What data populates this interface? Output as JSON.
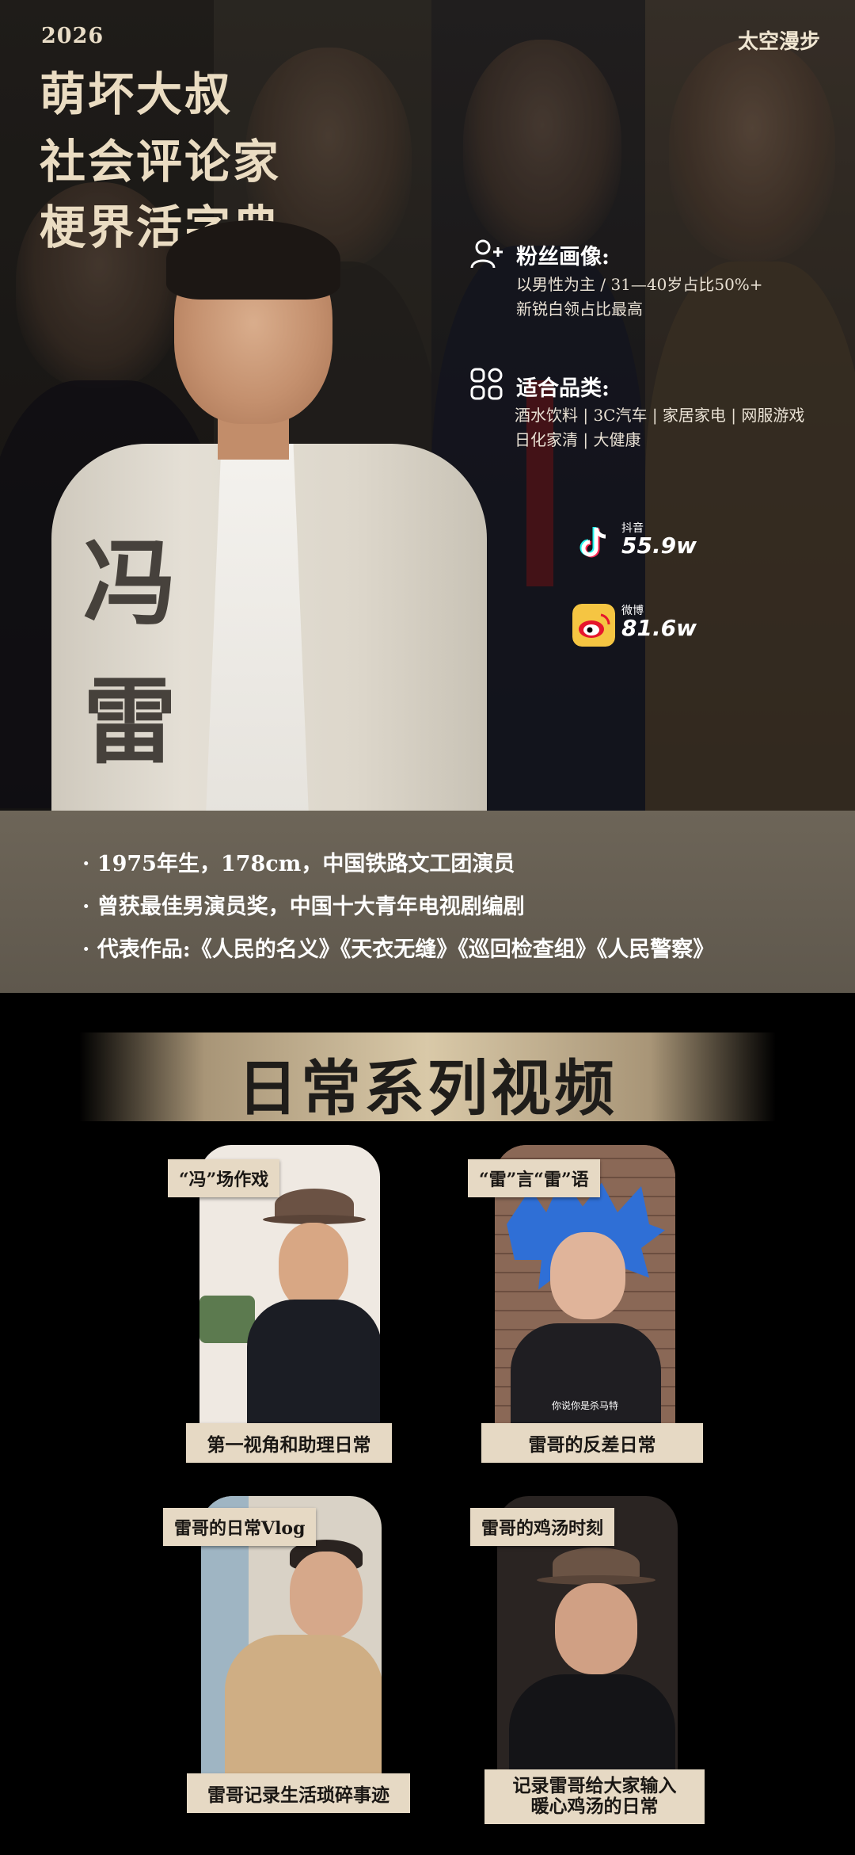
{
  "header": {
    "year": "2026",
    "brand": "太空漫步",
    "taglines": [
      "萌坏大叔",
      "社会评论家",
      "梗界活字典"
    ]
  },
  "name": {
    "char1": "冯",
    "char2": "雷"
  },
  "fans": {
    "icon": "user-plus-icon",
    "title": "粉丝画像:",
    "lines": [
      "以男性为主 / 31—40岁占比50%+",
      "新锐白领占比最高"
    ]
  },
  "categories": {
    "icon": "grid-icon",
    "title": "适合品类:",
    "lines": [
      "酒水饮料 | 3C汽车 | 家居家电 | 网服游戏",
      "日化家清 | 大健康"
    ]
  },
  "social": [
    {
      "icon": "douyin-icon",
      "platform": "抖音",
      "count": "55.9w",
      "color": "#000000"
    },
    {
      "icon": "weibo-icon",
      "platform": "微博",
      "count": "81.6w",
      "color": "#f5c542"
    }
  ],
  "bio": [
    "· 1975年生，178cm，中国铁路文工团演员",
    "· 曾获最佳男演员奖，中国十大青年电视剧编剧",
    "· 代表作品:《人民的名义》《天衣无缝》《巡回检查组》《人民警察》"
  ],
  "daily": {
    "title": "日常系列视频",
    "videos": [
      {
        "label": "“冯”场作戏",
        "caption": "第一视角和助理日常"
      },
      {
        "label": "“雷”言“雷”语",
        "caption": "雷哥的反差日常",
        "subtitle": "你说你是杀马特"
      },
      {
        "label": "雷哥的日常Vlog",
        "caption": "雷哥记录生活琐碎事迹"
      },
      {
        "label": "雷哥的鸡汤时刻",
        "caption_line1": "记录雷哥给大家输入",
        "caption_line2": "暖心鸡汤的日常"
      }
    ]
  }
}
